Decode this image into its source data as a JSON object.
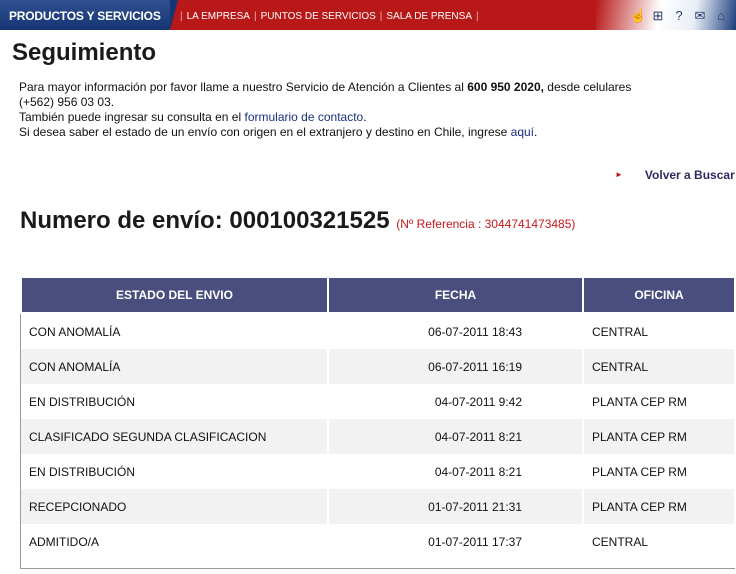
{
  "header": {
    "brand": "PRODUCTOS Y SERVICIOS",
    "nav": [
      "LA EMPRESA",
      "PUNTOS DE SERVICIOS",
      "SALA DE PRENSA"
    ],
    "tool_icons": [
      "hand-pointer-icon",
      "sitemap-icon",
      "help-icon",
      "mail-icon",
      "home-icon"
    ],
    "colors": {
      "bar": "#b81818",
      "brand": "#163574"
    }
  },
  "page": {
    "title": "Seguimiento",
    "info_line1_pre": "Para mayor información por favor llame a nuestro Servicio de Atención a Clientes al ",
    "info_phone": "600 950 2020,",
    "info_line1_post": " desde celulares",
    "info_line2": "(+562) 956 03 03.",
    "info_line3_pre": "También puede ingresar su consulta en el ",
    "info_line3_link": "formulario de contacto",
    "info_line3_post": ".",
    "info_line4_pre": "Si desea saber el estado de un envío con origen en el extranjero y destino en Chile, ingrese ",
    "info_line4_link": "aquí",
    "info_line4_post": ".",
    "back_label": "Volver a Buscar",
    "envio_label": "Numero de envío: 000100321525",
    "referencia": "(Nº Referencia : 3044741473485)"
  },
  "table": {
    "headers": [
      "ESTADO DEL ENVIO",
      "FECHA",
      "OFICINA"
    ],
    "rows": [
      {
        "estado": "CON ANOMALÍA",
        "fecha": "06-07-2011 18:43",
        "oficina": "CENTRAL"
      },
      {
        "estado": "CON ANOMALÍA",
        "fecha": "06-07-2011 16:19",
        "oficina": "CENTRAL"
      },
      {
        "estado": "EN DISTRIBUCIÓN",
        "fecha": "04-07-2011 9:42",
        "oficina": "PLANTA CEP RM"
      },
      {
        "estado": "CLASIFICADO SEGUNDA CLASIFICACION",
        "fecha": "04-07-2011 8:21",
        "oficina": "PLANTA CEP RM"
      },
      {
        "estado": "EN DISTRIBUCIÓN",
        "fecha": "04-07-2011 8:21",
        "oficina": "PLANTA CEP RM"
      },
      {
        "estado": "RECEPCIONADO",
        "fecha": "01-07-2011 21:31",
        "oficina": "PLANTA CEP RM"
      },
      {
        "estado": "ADMITIDO/A",
        "fecha": "01-07-2011 17:37",
        "oficina": "CENTRAL"
      }
    ]
  }
}
